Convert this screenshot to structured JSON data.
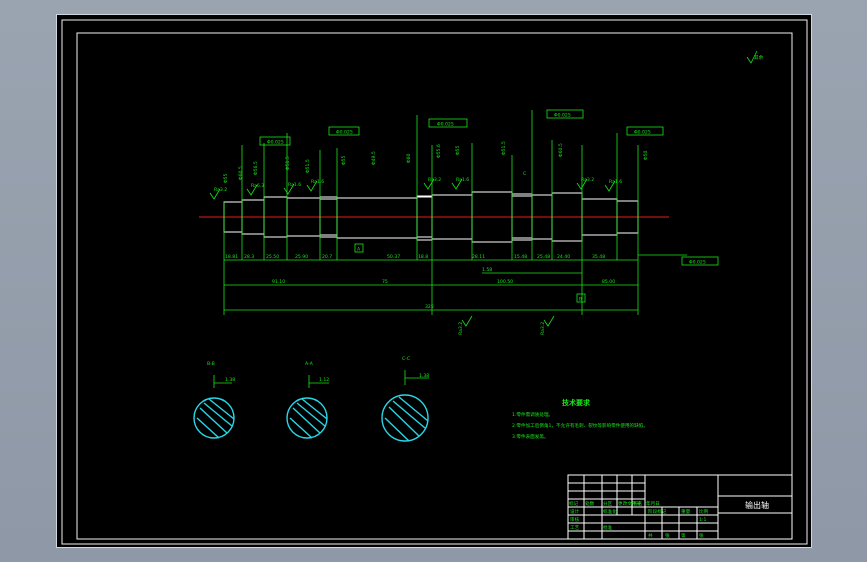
{
  "drawing": {
    "name": "输出轴",
    "tech_requirements": {
      "heading": "技术要求",
      "items": [
        "1.零件需调质处理。",
        "2.零件加工后倒角1，不允许有毛刺、裂纹等影响零件使用的缺陷。",
        "3.零件表面发黑。"
      ]
    },
    "section_labels": [
      "B-B",
      "A-A",
      "C-C"
    ],
    "section_dims": [
      "1.38",
      "1.12",
      "1.38"
    ],
    "dimensions": {
      "bottom_segments": [
        "18.81",
        "28.3",
        "25.50",
        "25.90",
        "20.7",
        "50.37",
        "18.8",
        "28.11",
        "15.48",
        "25.48",
        "24.40",
        "35.48"
      ],
      "totals": [
        "91.10",
        "75",
        "100.50",
        "85.00",
        "325"
      ],
      "diameters_top": [
        "Φ55",
        "Φ60.5",
        "Φ56.5",
        "Φ51.5",
        "Φ51.5",
        "Φ55",
        "Φ49.5",
        "Φ60",
        "Φ55.6",
        "Φ55",
        "Φ51.5",
        "Φ60.5",
        "Φ50"
      ],
      "tolerance_frames": [
        "Φ0.025",
        "Φ0.025",
        "Φ0.025",
        "Φ0.025",
        "Φ0.025",
        "Φ0.025"
      ],
      "surface_roughness": [
        "Ra3.2",
        "Ra6.3",
        "Ra1.6",
        "Ra1.6",
        "Ra3.2",
        "Ra1.6",
        "Ra3.2",
        "Ra1.6",
        "Ra3.2",
        "Ra3.2"
      ],
      "other": [
        "1.58",
        "C",
        "A",
        "B",
        "其余"
      ]
    },
    "title_block": {
      "row_labels": [
        "标记",
        "处数",
        "分区",
        "更改文件号",
        "签名",
        "年月日"
      ],
      "cells": [
        "设计",
        "标准化",
        "审核",
        "工艺",
        "阶段标记",
        "重量",
        "比例",
        "批准",
        "共",
        "张",
        "第",
        "张"
      ],
      "scale": "1:1"
    }
  }
}
